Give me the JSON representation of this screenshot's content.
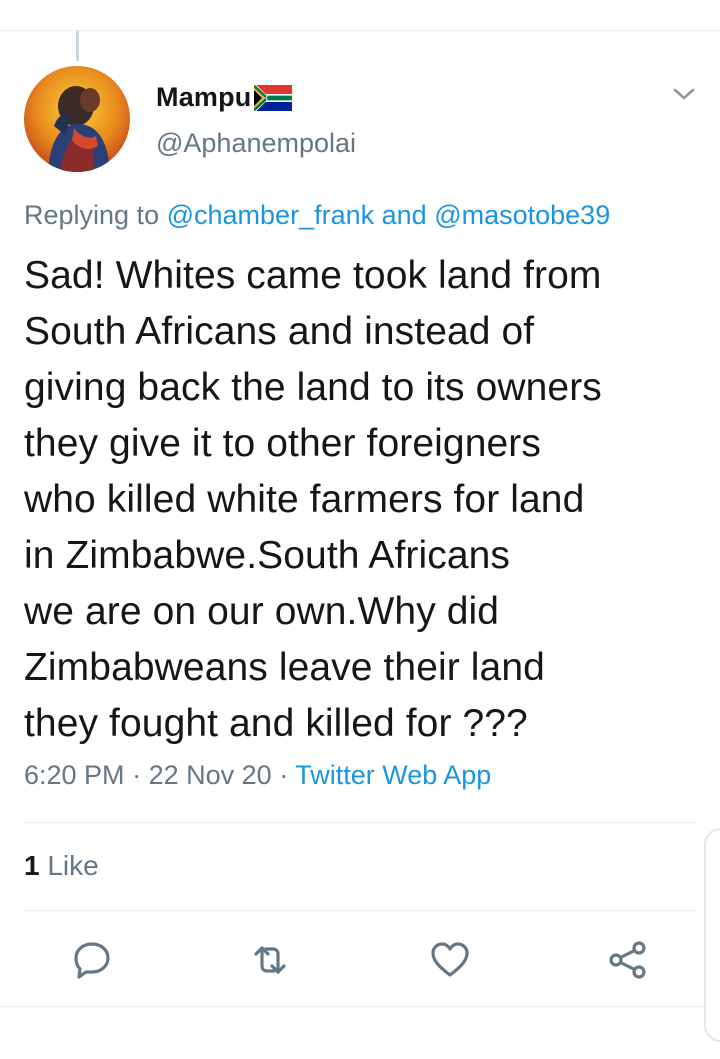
{
  "tweet": {
    "author": {
      "display_name": "Mampu",
      "handle": "@Aphanempolai",
      "flag_icon": "south-africa-flag-icon"
    },
    "replying_prefix": "Replying to",
    "replying_mention_1": "@chamber_frank",
    "replying_and": "and",
    "replying_mention_2": "@masotobe39",
    "text": "Sad! Whites came took land from\nSouth Africans and instead of\ngiving back the land to its owners\nthey give it to other foreigners\nwho killed white farmers for land\nin Zimbabwe.South Africans\nwe are on our own.Why did\nZimbabweans leave their land\nthey fought and killed for ???",
    "time": "6:20 PM",
    "separator": "·",
    "date": "22 Nov 20",
    "source": "Twitter Web App",
    "likes_count": "1",
    "likes_label": "Like"
  },
  "actions": [
    "reply-icon",
    "retweet-icon",
    "like-icon",
    "share-icon"
  ],
  "colors": {
    "text": "#14171a",
    "secondary": "#657786",
    "link": "#1b95e0",
    "divider": "#e6ecf0"
  }
}
